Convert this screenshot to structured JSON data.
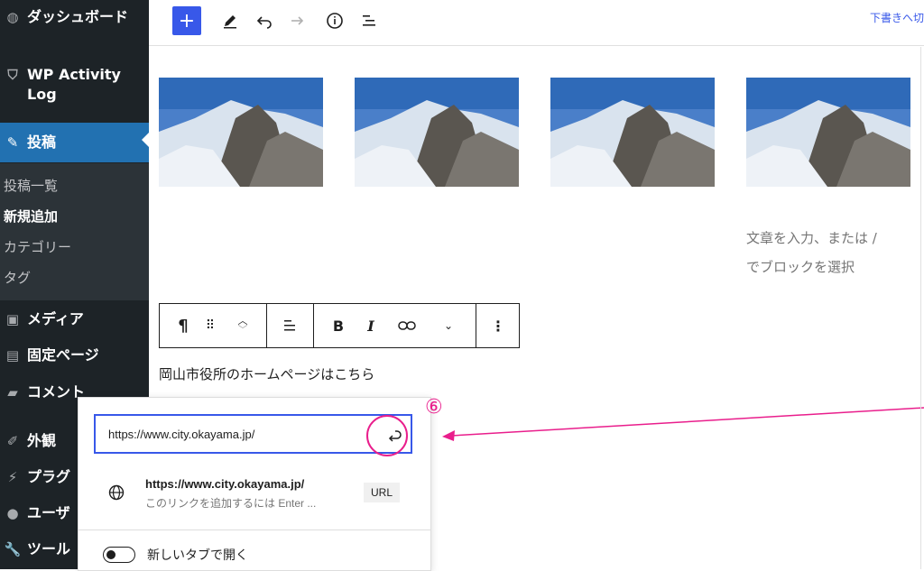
{
  "sidebar": {
    "items": [
      {
        "label": "ダッシュボード",
        "icon": "dashboard-icon"
      },
      {
        "label": "WP Activity Log",
        "icon": "shield-icon"
      },
      {
        "label": "投稿",
        "icon": "pin-icon"
      },
      {
        "label": "メディア",
        "icon": "media-icon"
      },
      {
        "label": "固定ページ",
        "icon": "page-icon"
      },
      {
        "label": "コメント",
        "icon": "comment-icon"
      },
      {
        "label": "外観",
        "icon": "brush-icon"
      },
      {
        "label": "プラグ",
        "icon": "plugin-icon"
      },
      {
        "label": "ユーザ",
        "icon": "user-icon"
      },
      {
        "label": "ツール",
        "icon": "wrench-icon"
      }
    ],
    "submenu": [
      "投稿一覧",
      "新規追加",
      "カテゴリー",
      "タグ"
    ]
  },
  "topbar": {
    "add": "+",
    "draft": "下書きへ切"
  },
  "editor": {
    "placeholder_line1": "文章を入力、または /",
    "placeholder_line2": "でブロックを選択",
    "paragraph": "岡山市役所のホームページはこちら"
  },
  "block_toolbar": {
    "paragraph_icon": "¶",
    "bold": "B",
    "italic": "I"
  },
  "link_popover": {
    "url_value": "https://www.city.okayama.jp/",
    "suggestion_title": "https://www.city.okayama.jp/",
    "suggestion_subtitle": "このリンクを追加するには Enter ...",
    "suggestion_type": "URL",
    "toggle_label": "新しいタブで開く"
  },
  "annotation": {
    "step": "⑥",
    "color": "#e91e8c"
  },
  "colors": {
    "accent": "#3858e9",
    "sidebar_bg": "#1d2327",
    "active": "#2271b1"
  }
}
